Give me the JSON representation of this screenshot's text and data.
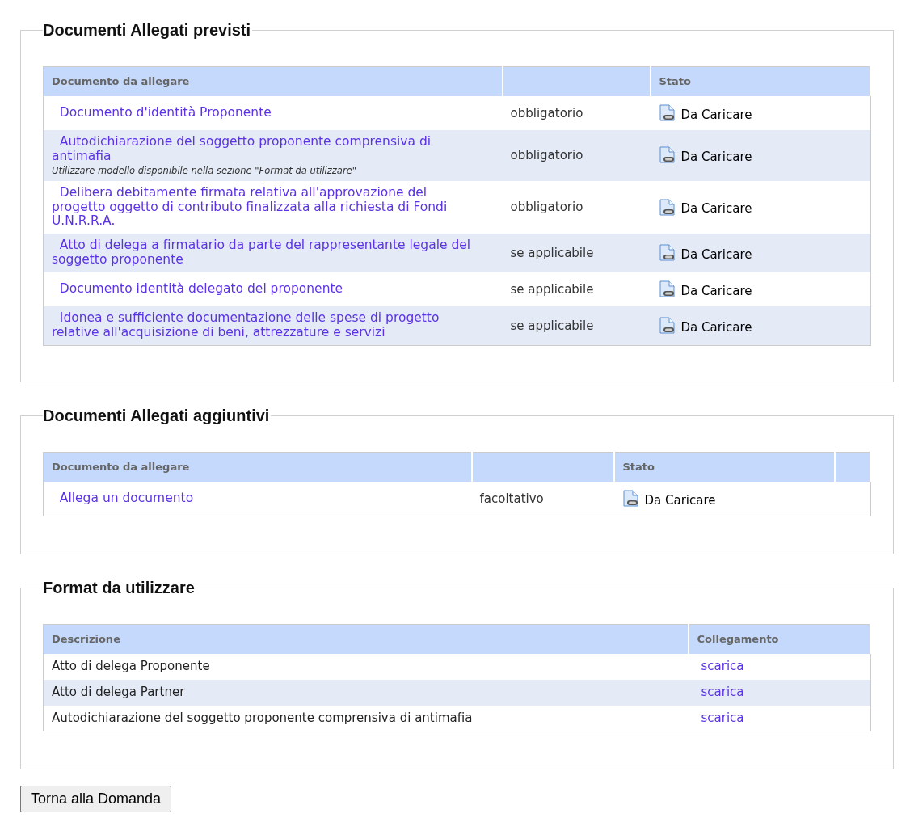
{
  "sections": [
    {
      "kind": "attachments",
      "title": "Documenti Allegati previsti",
      "columns": [
        "Documento da allegare",
        "",
        "Stato"
      ],
      "rows": [
        {
          "document": "Documento d'identità Proponente",
          "requirement": "obbligatorio",
          "status": "Da Caricare"
        },
        {
          "document": "Autodichiarazione del soggetto proponente comprensiva di antimafia",
          "note": "Utilizzare modello disponibile nella sezione \"Format da utilizzare\"",
          "requirement": "obbligatorio",
          "status": "Da Caricare"
        },
        {
          "document": "Delibera debitamente firmata relativa all'approvazione del progetto oggetto di contributo finalizzata alla richiesta di Fondi U.N.R.R.A.",
          "requirement": "obbligatorio",
          "status": "Da Caricare"
        },
        {
          "document": "Atto di delega a firmatario da parte del rappresentante legale del soggetto proponente",
          "requirement": "se applicabile",
          "status": "Da Caricare"
        },
        {
          "document": "Documento identità delegato del proponente",
          "requirement": "se applicabile",
          "status": "Da Caricare"
        },
        {
          "document": "Idonea e sufficiente documentazione delle spese di progetto relative all'acquisizione di beni, attrezzature e servizi",
          "requirement": "se applicabile",
          "status": "Da Caricare"
        }
      ]
    },
    {
      "kind": "additional",
      "title": "Documenti Allegati aggiuntivi",
      "columns": [
        "Documento da allegare",
        "",
        "Stato",
        ""
      ],
      "rows": [
        {
          "document": "Allega un documento",
          "requirement": "facoltativo",
          "status": "Da Caricare"
        }
      ]
    },
    {
      "kind": "formats",
      "title": "Format da utilizzare",
      "columns": [
        "Descrizione",
        "Collegamento"
      ],
      "rows": [
        {
          "description": "Atto di delega Proponente",
          "link": "scarica"
        },
        {
          "description": "Atto di delega Partner",
          "link": "scarica"
        },
        {
          "description": "Autodichiarazione del soggetto proponente comprensiva di antimafia",
          "link": "scarica"
        }
      ]
    }
  ],
  "back_button": "Torna alla Domanda"
}
